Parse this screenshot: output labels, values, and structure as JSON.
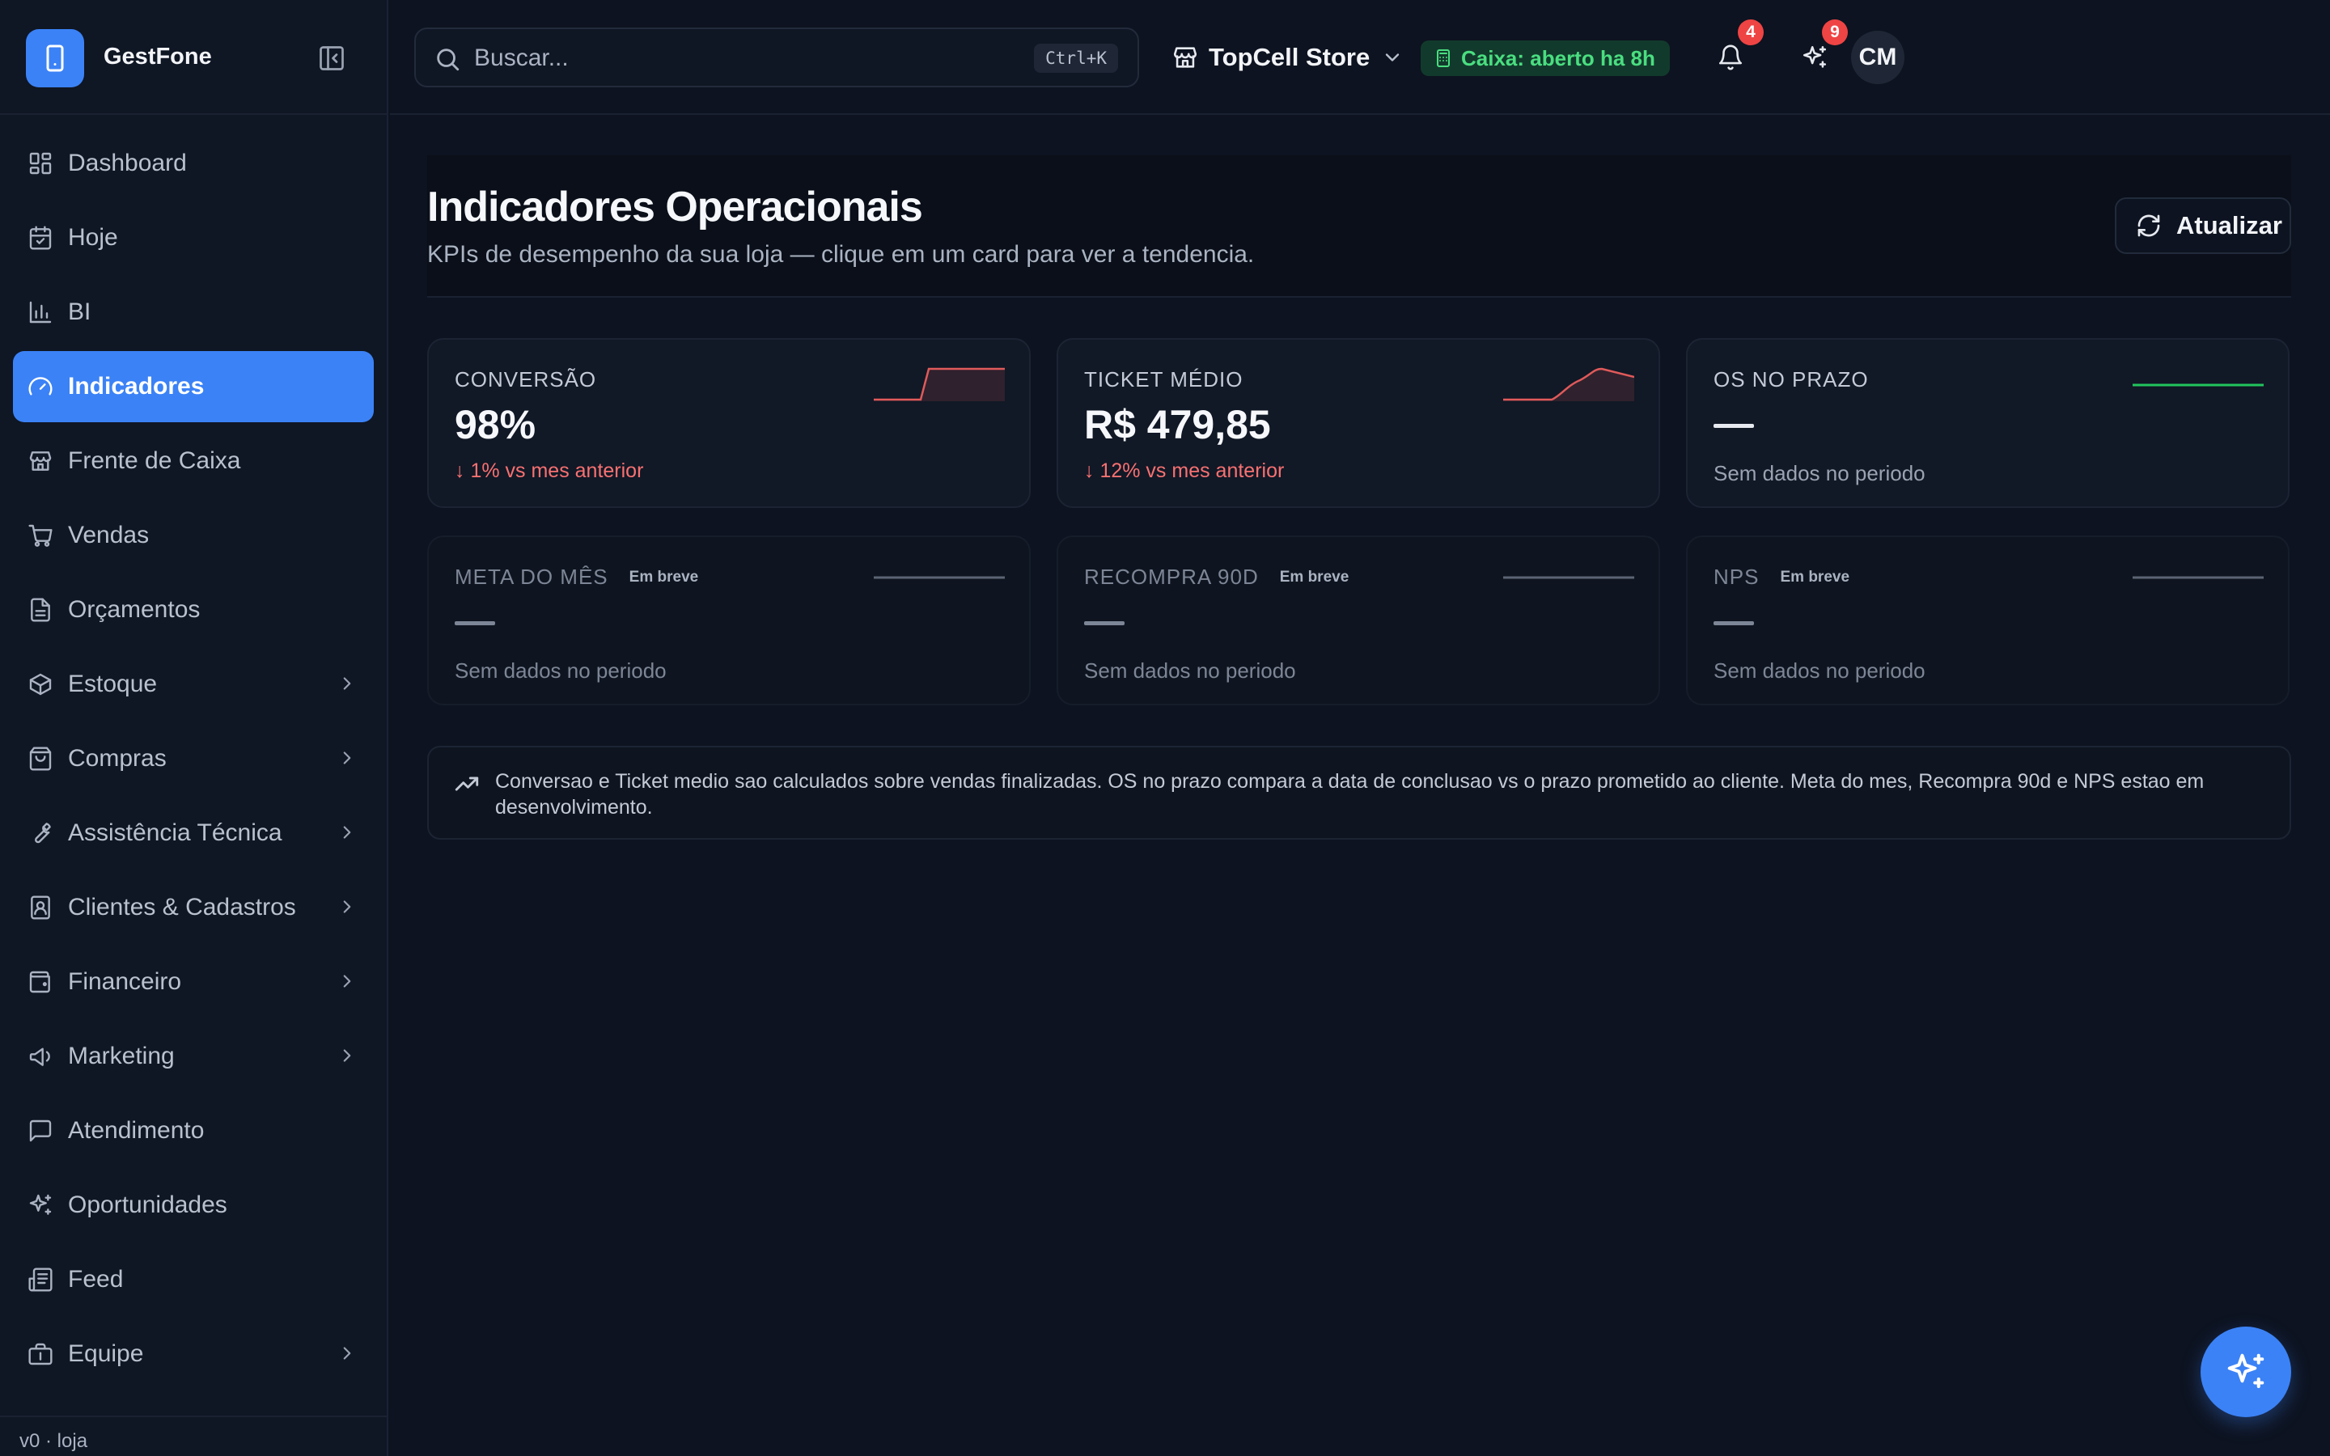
{
  "brand": {
    "name": "GestFone"
  },
  "sidebar": {
    "items": [
      {
        "label": "Dashboard",
        "icon": "dashboard-icon",
        "expandable": false
      },
      {
        "label": "Hoje",
        "icon": "calendar-icon",
        "expandable": false
      },
      {
        "label": "BI",
        "icon": "bar-chart-icon",
        "expandable": false
      },
      {
        "label": "Indicadores",
        "icon": "gauge-icon",
        "expandable": false,
        "active": true
      },
      {
        "label": "Frente de Caixa",
        "icon": "store-icon",
        "expandable": false
      },
      {
        "label": "Vendas",
        "icon": "cart-icon",
        "expandable": false
      },
      {
        "label": "Orçamentos",
        "icon": "document-icon",
        "expandable": false
      },
      {
        "label": "Estoque",
        "icon": "package-icon",
        "expandable": true
      },
      {
        "label": "Compras",
        "icon": "shopping-bag-icon",
        "expandable": true
      },
      {
        "label": "Assistência Técnica",
        "icon": "wrench-icon",
        "expandable": true
      },
      {
        "label": "Clientes & Cadastros",
        "icon": "contacts-icon",
        "expandable": true
      },
      {
        "label": "Financeiro",
        "icon": "wallet-icon",
        "expandable": true
      },
      {
        "label": "Marketing",
        "icon": "megaphone-icon",
        "expandable": true
      },
      {
        "label": "Atendimento",
        "icon": "message-icon",
        "expandable": false
      },
      {
        "label": "Oportunidades",
        "icon": "sparkles-icon",
        "expandable": false
      },
      {
        "label": "Feed",
        "icon": "newspaper-icon",
        "expandable": false
      },
      {
        "label": "Equipe",
        "icon": "briefcase-icon",
        "expandable": true
      }
    ],
    "version": "v0 · loja"
  },
  "topbar": {
    "search_placeholder": "Buscar...",
    "shortcut": "Ctrl+K",
    "store_name": "TopCell Store",
    "cashier_status": "Caixa: aberto ha 8h",
    "notifications_count": "4",
    "opportunities_count": "9",
    "avatar_initials": "CM"
  },
  "page": {
    "title": "Indicadores Operacionais",
    "subtitle": "KPIs de desempenho da sua loja — clique em um card para ver a tendencia.",
    "refresh_label": "Atualizar"
  },
  "cards": [
    {
      "label": "CONVERSÃO",
      "value": "98%",
      "trend": "↓ 1% vs mes anterior",
      "spark_color": "#e05a5a"
    },
    {
      "label": "TICKET MÉDIO",
      "value": "R$ 479,85",
      "trend": "↓ 12% vs mes anterior",
      "spark_color": "#e05a5a"
    },
    {
      "label": "OS NO PRAZO",
      "value": "—",
      "note": "Sem dados no periodo",
      "spark_color": "#22c55e"
    },
    {
      "label": "META DO MÊS",
      "badge": "Em breve",
      "value": "—",
      "note": "Sem dados no periodo"
    },
    {
      "label": "RECOMPRA 90D",
      "badge": "Em breve",
      "value": "—",
      "note": "Sem dados no periodo"
    },
    {
      "label": "NPS",
      "badge": "Em breve",
      "value": "—",
      "note": "Sem dados no periodo"
    }
  ],
  "info": {
    "text": "Conversao e Ticket medio sao calculados sobre vendas finalizadas. OS no prazo compara a data de conclusao vs o prazo prometido ao cliente. Meta do mes, Recompra 90d e NPS estao em desenvolvimento."
  },
  "colors": {
    "accent": "#3b82f6",
    "negative": "#f87171",
    "positive": "#4ade80",
    "background": "#0d1320"
  }
}
